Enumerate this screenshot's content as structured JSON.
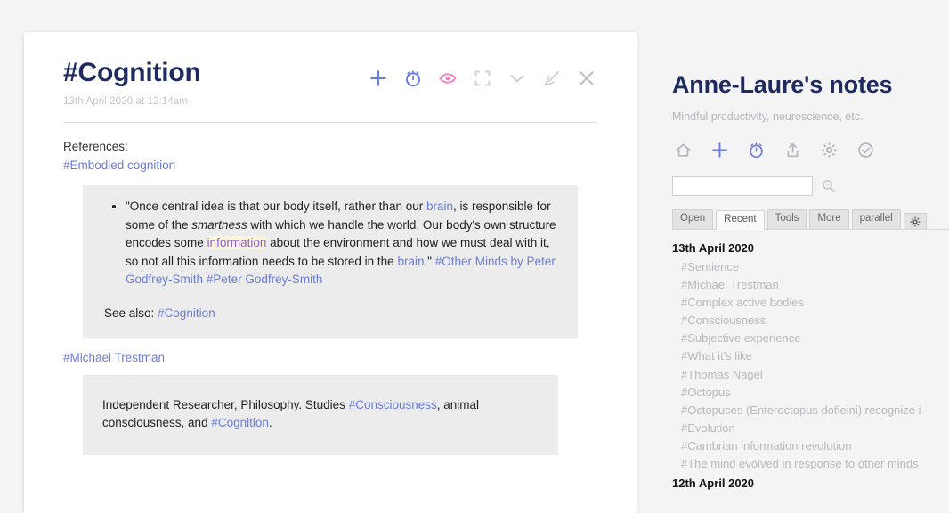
{
  "note": {
    "title": "#Cognition",
    "date": "13th April 2020 at 12:14am",
    "toolbar": [
      {
        "name": "add-icon",
        "label": "Add"
      },
      {
        "name": "alarm-icon",
        "label": "Reminder"
      },
      {
        "name": "eye-icon",
        "label": "Watch"
      },
      {
        "name": "expand-icon",
        "label": "Expand"
      },
      {
        "name": "chevron-down-icon",
        "label": "Collapse"
      },
      {
        "name": "pencil-icon",
        "label": "Edit"
      },
      {
        "name": "close-icon",
        "label": "Close"
      }
    ],
    "references_label": "References:",
    "reference_link": "#Embodied cognition",
    "quote": {
      "part1": "\"Once central idea is that our body itself, rather than our ",
      "link_brain_1": "brain",
      "part2": ", is responsible for some of the ",
      "emphasis": "smartness",
      "part3": " with which we handle the world. Our body's own structure encodes some ",
      "highlight": "information",
      "part4": " about the environment and how we must deal with it, so not all this information needs to be stored in the ",
      "link_brain_2": "brain",
      "part5": ".\" ",
      "link_other_minds": "#Other Minds by Peter Godfrey-Smith",
      "link_peter": "#Peter Godfrey-Smith"
    },
    "see_also_label": "See also: ",
    "see_also_link": "#Cognition",
    "trestman_tag": "#Michael Trestman",
    "bio": {
      "part1": "Independent Researcher, Philosophy. Studies ",
      "link1": "#Consciousness",
      "part2": ", animal consciousness, and ",
      "link2": "#Cognition",
      "part3": "."
    }
  },
  "sidebar": {
    "title": "Anne-Laure's notes",
    "subtitle": "Mindful productivity, neuroscience, etc.",
    "icons": [
      {
        "name": "home-icon",
        "label": "Home"
      },
      {
        "name": "add-icon",
        "label": "Add"
      },
      {
        "name": "alarm-icon",
        "label": "Reminder"
      },
      {
        "name": "share-icon",
        "label": "Share"
      },
      {
        "name": "gear-icon",
        "label": "Settings"
      },
      {
        "name": "check-circle-icon",
        "label": "Done"
      }
    ],
    "search": {
      "value": "",
      "placeholder": "",
      "icon": "search-icon"
    },
    "tabs": [
      {
        "label": "Open",
        "active": false
      },
      {
        "label": "Recent",
        "active": true
      },
      {
        "label": "Tools",
        "active": false
      },
      {
        "label": "More",
        "active": false
      },
      {
        "label": "parallel",
        "active": false
      }
    ],
    "tabs_gear": "gear-icon",
    "groups": [
      {
        "date": "13th April 2020",
        "items": [
          "#Sentience",
          "#Michael Trestman",
          "#Complex active bodies",
          "#Consciousness",
          "#Subjective experience",
          "#What it's like",
          "#Thomas Nagel",
          "#Octopus",
          "#Octopuses (Enteroctopus dofleini) recognize i",
          "#Evolution",
          "#Cambrian information revolution",
          "#The mind evolved in response to other minds"
        ]
      },
      {
        "date": "12th April 2020",
        "items": []
      }
    ]
  },
  "colors": {
    "accent_blue": "#6b7ce0",
    "accent_pink": "#ef82c0",
    "title_navy": "#1f2b5e",
    "highlight_bg": "#fdf6d8",
    "highlight_text": "#8a62d6",
    "block_bg": "#ececec",
    "page_bg": "#f4f4f5"
  }
}
